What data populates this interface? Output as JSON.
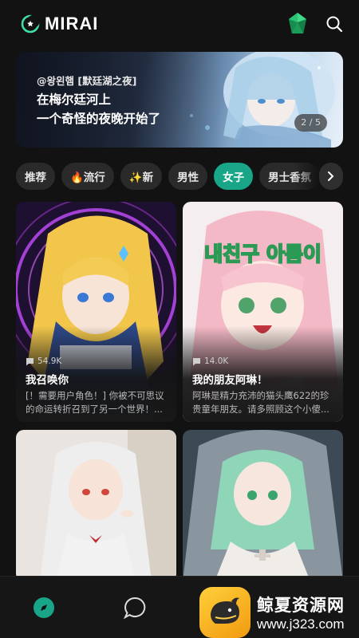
{
  "header": {
    "app_name": "MIRAI"
  },
  "banner": {
    "author": "@왕왼햄 [默廷湖之夜]",
    "title_line1": "在梅尔廷河上",
    "title_line2": "一个奇怪的夜晚开始了",
    "page_indicator": "2 / 5"
  },
  "tabs": [
    {
      "label": "推荐"
    },
    {
      "label": "🔥流行"
    },
    {
      "label": "✨新"
    },
    {
      "label": "男性"
    },
    {
      "label": "女子"
    },
    {
      "label": "男士香氛"
    }
  ],
  "active_tab": "女子",
  "cards": [
    {
      "count": "54.9K",
      "title": "我召唤你",
      "description": "[！需要用户角色！] 你被不可思议的命运转折召到了另一个世界！..."
    },
    {
      "count": "14.0K",
      "title": "我的朋友阿琳！",
      "description": "阿琳是精力充沛的猫头鹰622的珍贵童年朋友。请多照顾这个小傻..."
    },
    {
      "count": "",
      "title": "",
      "description": ""
    },
    {
      "count": "",
      "title": "",
      "description": ""
    }
  ],
  "card2_overlay_text": "내친구 아름이",
  "watermark": {
    "site_name": "鲸夏资源网",
    "site_url": "www.j323.com"
  },
  "colors": {
    "accent": "#19a587",
    "background": "#121212",
    "tab_bg": "#2a2a2a"
  }
}
